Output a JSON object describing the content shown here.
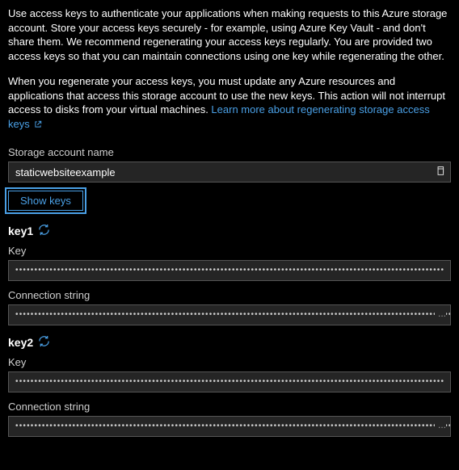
{
  "intro": "Use access keys to authenticate your applications when making requests to this Azure storage account. Store your access keys securely - for example, using Azure Key Vault - and don't share them. We recommend regenerating your access keys regularly. You are provided two access keys so that you can maintain connections using one key while regenerating the other.",
  "warning": "When you regenerate your access keys, you must update any Azure resources and applications that access this storage account to use the new keys. This action will not interrupt access to disks from your virtual machines. ",
  "link_label": "Learn more about regenerating storage access keys",
  "storage_account": {
    "label": "Storage account name",
    "value": "staticwebsiteexample"
  },
  "show_keys_label": "Show keys",
  "dots_short": "•••••••••••••••••••••••••••••••••••••••••••••••••••••••••••••••••••••••••••••••••••••••••••••••••••••••••••••••••",
  "dots_long": "••••••••••••••••••••••••••••••••••••••••••••••••••••••••••••••••••••••••••••••••••••••••••••••••••••••••••••••••••••••••••••••••••••",
  "key1": {
    "title": "key1",
    "key_label": "Key",
    "conn_label": "Connection string"
  },
  "key2": {
    "title": "key2",
    "key_label": "Key",
    "conn_label": "Connection string"
  },
  "ellipsis": "..."
}
